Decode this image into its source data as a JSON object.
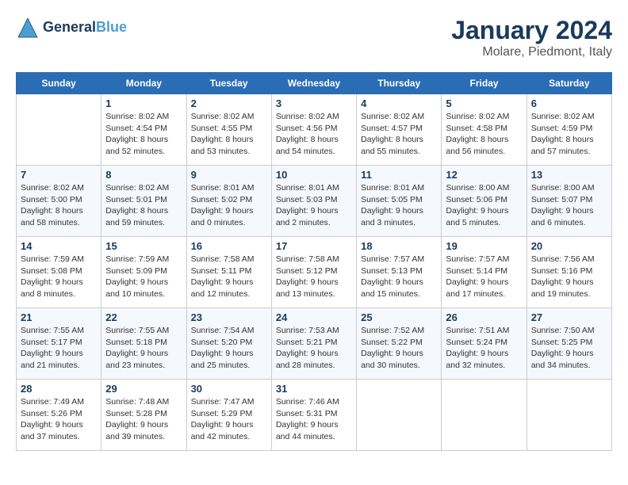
{
  "header": {
    "logo_line1": "General",
    "logo_line2": "Blue",
    "title": "January 2024",
    "subtitle": "Molare, Piedmont, Italy"
  },
  "days_header": [
    "Sunday",
    "Monday",
    "Tuesday",
    "Wednesday",
    "Thursday",
    "Friday",
    "Saturday"
  ],
  "weeks": [
    [
      {
        "num": "",
        "sunrise": "",
        "sunset": "",
        "daylight": ""
      },
      {
        "num": "1",
        "sunrise": "Sunrise: 8:02 AM",
        "sunset": "Sunset: 4:54 PM",
        "daylight": "Daylight: 8 hours and 52 minutes."
      },
      {
        "num": "2",
        "sunrise": "Sunrise: 8:02 AM",
        "sunset": "Sunset: 4:55 PM",
        "daylight": "Daylight: 8 hours and 53 minutes."
      },
      {
        "num": "3",
        "sunrise": "Sunrise: 8:02 AM",
        "sunset": "Sunset: 4:56 PM",
        "daylight": "Daylight: 8 hours and 54 minutes."
      },
      {
        "num": "4",
        "sunrise": "Sunrise: 8:02 AM",
        "sunset": "Sunset: 4:57 PM",
        "daylight": "Daylight: 8 hours and 55 minutes."
      },
      {
        "num": "5",
        "sunrise": "Sunrise: 8:02 AM",
        "sunset": "Sunset: 4:58 PM",
        "daylight": "Daylight: 8 hours and 56 minutes."
      },
      {
        "num": "6",
        "sunrise": "Sunrise: 8:02 AM",
        "sunset": "Sunset: 4:59 PM",
        "daylight": "Daylight: 8 hours and 57 minutes."
      }
    ],
    [
      {
        "num": "7",
        "sunrise": "Sunrise: 8:02 AM",
        "sunset": "Sunset: 5:00 PM",
        "daylight": "Daylight: 8 hours and 58 minutes."
      },
      {
        "num": "8",
        "sunrise": "Sunrise: 8:02 AM",
        "sunset": "Sunset: 5:01 PM",
        "daylight": "Daylight: 8 hours and 59 minutes."
      },
      {
        "num": "9",
        "sunrise": "Sunrise: 8:01 AM",
        "sunset": "Sunset: 5:02 PM",
        "daylight": "Daylight: 9 hours and 0 minutes."
      },
      {
        "num": "10",
        "sunrise": "Sunrise: 8:01 AM",
        "sunset": "Sunset: 5:03 PM",
        "daylight": "Daylight: 9 hours and 2 minutes."
      },
      {
        "num": "11",
        "sunrise": "Sunrise: 8:01 AM",
        "sunset": "Sunset: 5:05 PM",
        "daylight": "Daylight: 9 hours and 3 minutes."
      },
      {
        "num": "12",
        "sunrise": "Sunrise: 8:00 AM",
        "sunset": "Sunset: 5:06 PM",
        "daylight": "Daylight: 9 hours and 5 minutes."
      },
      {
        "num": "13",
        "sunrise": "Sunrise: 8:00 AM",
        "sunset": "Sunset: 5:07 PM",
        "daylight": "Daylight: 9 hours and 6 minutes."
      }
    ],
    [
      {
        "num": "14",
        "sunrise": "Sunrise: 7:59 AM",
        "sunset": "Sunset: 5:08 PM",
        "daylight": "Daylight: 9 hours and 8 minutes."
      },
      {
        "num": "15",
        "sunrise": "Sunrise: 7:59 AM",
        "sunset": "Sunset: 5:09 PM",
        "daylight": "Daylight: 9 hours and 10 minutes."
      },
      {
        "num": "16",
        "sunrise": "Sunrise: 7:58 AM",
        "sunset": "Sunset: 5:11 PM",
        "daylight": "Daylight: 9 hours and 12 minutes."
      },
      {
        "num": "17",
        "sunrise": "Sunrise: 7:58 AM",
        "sunset": "Sunset: 5:12 PM",
        "daylight": "Daylight: 9 hours and 13 minutes."
      },
      {
        "num": "18",
        "sunrise": "Sunrise: 7:57 AM",
        "sunset": "Sunset: 5:13 PM",
        "daylight": "Daylight: 9 hours and 15 minutes."
      },
      {
        "num": "19",
        "sunrise": "Sunrise: 7:57 AM",
        "sunset": "Sunset: 5:14 PM",
        "daylight": "Daylight: 9 hours and 17 minutes."
      },
      {
        "num": "20",
        "sunrise": "Sunrise: 7:56 AM",
        "sunset": "Sunset: 5:16 PM",
        "daylight": "Daylight: 9 hours and 19 minutes."
      }
    ],
    [
      {
        "num": "21",
        "sunrise": "Sunrise: 7:55 AM",
        "sunset": "Sunset: 5:17 PM",
        "daylight": "Daylight: 9 hours and 21 minutes."
      },
      {
        "num": "22",
        "sunrise": "Sunrise: 7:55 AM",
        "sunset": "Sunset: 5:18 PM",
        "daylight": "Daylight: 9 hours and 23 minutes."
      },
      {
        "num": "23",
        "sunrise": "Sunrise: 7:54 AM",
        "sunset": "Sunset: 5:20 PM",
        "daylight": "Daylight: 9 hours and 25 minutes."
      },
      {
        "num": "24",
        "sunrise": "Sunrise: 7:53 AM",
        "sunset": "Sunset: 5:21 PM",
        "daylight": "Daylight: 9 hours and 28 minutes."
      },
      {
        "num": "25",
        "sunrise": "Sunrise: 7:52 AM",
        "sunset": "Sunset: 5:22 PM",
        "daylight": "Daylight: 9 hours and 30 minutes."
      },
      {
        "num": "26",
        "sunrise": "Sunrise: 7:51 AM",
        "sunset": "Sunset: 5:24 PM",
        "daylight": "Daylight: 9 hours and 32 minutes."
      },
      {
        "num": "27",
        "sunrise": "Sunrise: 7:50 AM",
        "sunset": "Sunset: 5:25 PM",
        "daylight": "Daylight: 9 hours and 34 minutes."
      }
    ],
    [
      {
        "num": "28",
        "sunrise": "Sunrise: 7:49 AM",
        "sunset": "Sunset: 5:26 PM",
        "daylight": "Daylight: 9 hours and 37 minutes."
      },
      {
        "num": "29",
        "sunrise": "Sunrise: 7:48 AM",
        "sunset": "Sunset: 5:28 PM",
        "daylight": "Daylight: 9 hours and 39 minutes."
      },
      {
        "num": "30",
        "sunrise": "Sunrise: 7:47 AM",
        "sunset": "Sunset: 5:29 PM",
        "daylight": "Daylight: 9 hours and 42 minutes."
      },
      {
        "num": "31",
        "sunrise": "Sunrise: 7:46 AM",
        "sunset": "Sunset: 5:31 PM",
        "daylight": "Daylight: 9 hours and 44 minutes."
      },
      {
        "num": "",
        "sunrise": "",
        "sunset": "",
        "daylight": ""
      },
      {
        "num": "",
        "sunrise": "",
        "sunset": "",
        "daylight": ""
      },
      {
        "num": "",
        "sunrise": "",
        "sunset": "",
        "daylight": ""
      }
    ]
  ]
}
